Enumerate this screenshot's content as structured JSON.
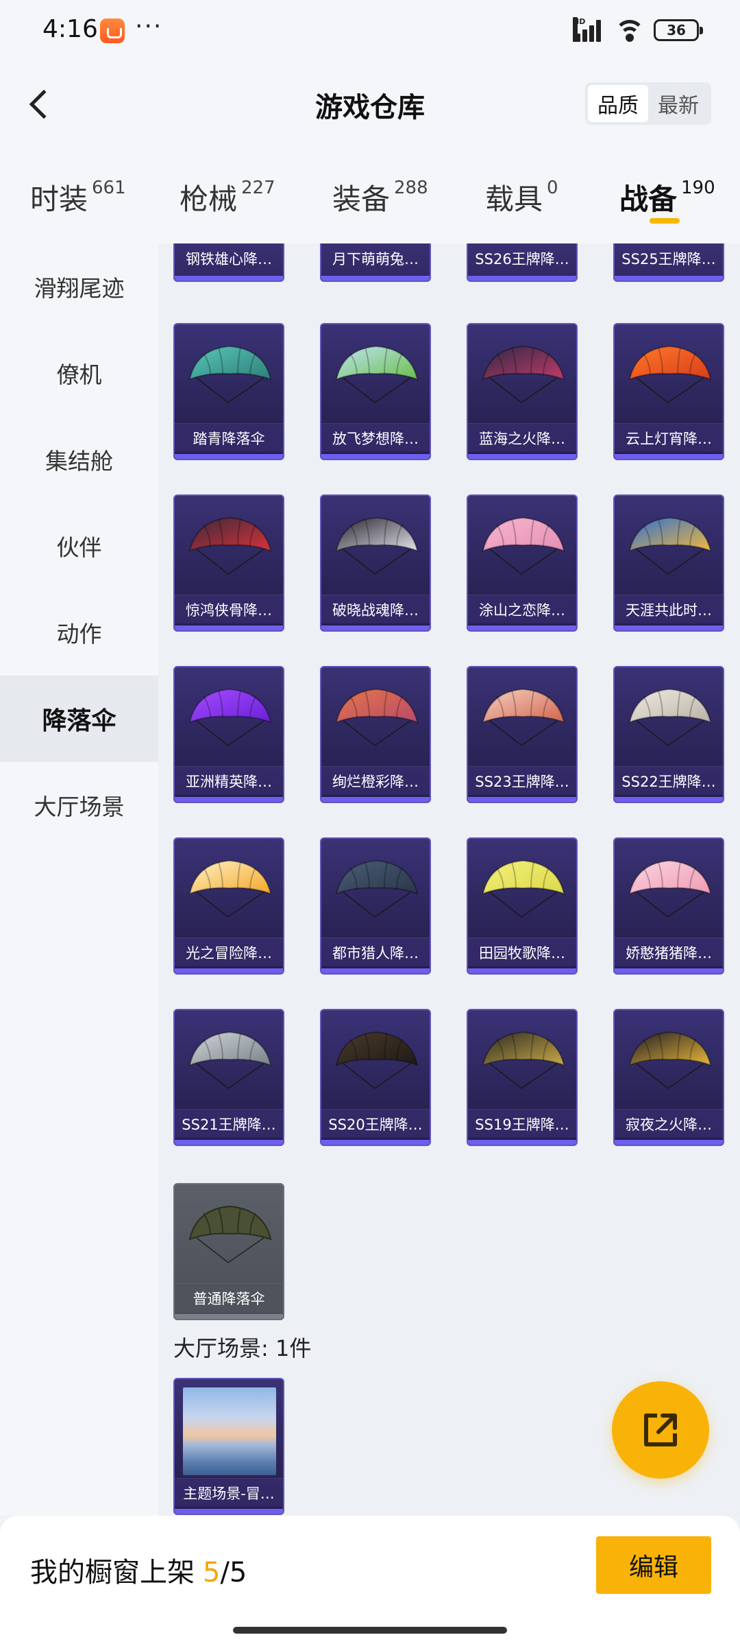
{
  "status_bar": {
    "time": "4:16",
    "more": "···",
    "network": "HD",
    "battery": "36"
  },
  "header": {
    "title": "游戏仓库",
    "sort_options": [
      "品质",
      "最新"
    ],
    "sort_selected": "品质"
  },
  "tabs": [
    {
      "label": "时装",
      "count": "661"
    },
    {
      "label": "枪械",
      "count": "227"
    },
    {
      "label": "装备",
      "count": "288"
    },
    {
      "label": "载具",
      "count": "0"
    },
    {
      "label": "战备",
      "count": "190",
      "active": true
    }
  ],
  "sidenav": [
    "滑翔尾迹",
    "僚机",
    "集结舱",
    "伙伴",
    "动作",
    "降落伞",
    "大厅场景"
  ],
  "sidenav_active": "降落伞",
  "partial_row": [
    "钢铁雄心降…",
    "月下萌萌兔…",
    "SS26王牌降…",
    "SS25王牌降…"
  ],
  "parachutes": [
    {
      "name": "踏青降落伞",
      "colors": [
        "#58c6b8",
        "#2f7f7a"
      ]
    },
    {
      "name": "放飞梦想降…",
      "colors": [
        "#bfe3f2",
        "#6bbf4a"
      ]
    },
    {
      "name": "蓝海之火降…",
      "colors": [
        "#2e2a44",
        "#c03a6a"
      ]
    },
    {
      "name": "云上灯宵降…",
      "colors": [
        "#ff7a28",
        "#d93c1c"
      ]
    },
    {
      "name": "惊鸿侠骨降…",
      "colors": [
        "#3a2a3a",
        "#d7323a"
      ]
    },
    {
      "name": "破晓战魂降…",
      "colors": [
        "#2a2630",
        "#e2e2e8"
      ]
    },
    {
      "name": "涂山之恋降…",
      "colors": [
        "#f7b6cf",
        "#e58fb3"
      ]
    },
    {
      "name": "天涯共此时…",
      "colors": [
        "#2f6fd0",
        "#f0b840"
      ]
    },
    {
      "name": "亚洲精英降…",
      "colors": [
        "#a44cff",
        "#6a1fd6"
      ]
    },
    {
      "name": "绚烂橙彩降…",
      "colors": [
        "#e5754a",
        "#b84b6a"
      ]
    },
    {
      "name": "SS23王牌降…",
      "colors": [
        "#f2d2c0",
        "#d4634e"
      ]
    },
    {
      "name": "SS22王牌降…",
      "colors": [
        "#efeae2",
        "#b9b2a6"
      ]
    },
    {
      "name": "光之冒险降…",
      "colors": [
        "#fff2c8",
        "#f2a626"
      ]
    },
    {
      "name": "都市猎人降…",
      "colors": [
        "#4a5d78",
        "#2b3648"
      ]
    },
    {
      "name": "田园牧歌降…",
      "colors": [
        "#f3f07a",
        "#dcd84a"
      ]
    },
    {
      "name": "娇憨猪猪降…",
      "colors": [
        "#fad6e0",
        "#f19ab3"
      ]
    },
    {
      "name": "SS21王牌降…",
      "colors": [
        "#cfd4d8",
        "#7a8289"
      ]
    },
    {
      "name": "SS20王牌降…",
      "colors": [
        "#4a3a2a",
        "#1f1a16"
      ]
    },
    {
      "name": "SS19王牌降…",
      "colors": [
        "#2c2b22",
        "#c9a94a"
      ]
    },
    {
      "name": "寂夜之火降…",
      "colors": [
        "#1f1e24",
        "#e8b63a"
      ]
    }
  ],
  "basic_parachute": {
    "name": "普通降落伞",
    "colors": [
      "#4a5034",
      "#2f3320"
    ]
  },
  "scene_section": {
    "label": "大厅场景: 1件"
  },
  "scene_item": {
    "name": "主题场景-冒…"
  },
  "bottom_bar": {
    "text": "我的橱窗上架",
    "shown": "5",
    "total": "/5",
    "edit_label": "编辑"
  }
}
